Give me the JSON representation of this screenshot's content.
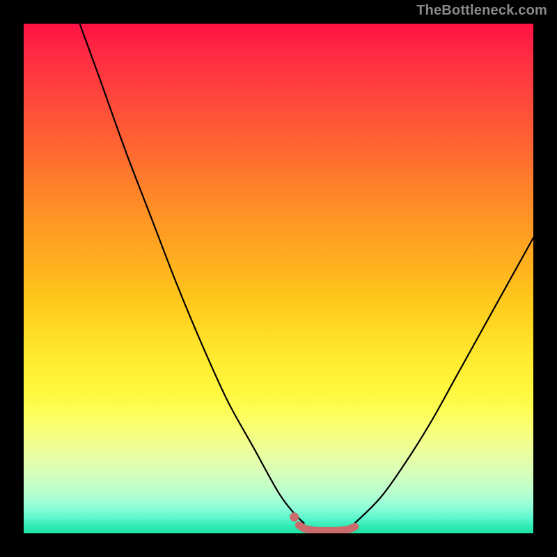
{
  "watermark": "TheBottleneck.com",
  "colors": {
    "curve": "#000000",
    "marker": "#CC6B6B",
    "background_black": "#000000"
  },
  "chart_data": {
    "type": "line",
    "title": "",
    "xlabel": "",
    "ylabel": "",
    "xlim": [
      0,
      100
    ],
    "ylim": [
      0,
      100
    ],
    "series": [
      {
        "name": "left-curve",
        "x": [
          11,
          15,
          20,
          25,
          30,
          35,
          40,
          45,
          50,
          53,
          55
        ],
        "y": [
          100,
          89,
          75,
          62,
          49,
          37,
          26,
          17,
          8,
          4,
          2
        ]
      },
      {
        "name": "right-curve",
        "x": [
          65,
          70,
          75,
          80,
          85,
          90,
          95,
          100
        ],
        "y": [
          2,
          7,
          14,
          22,
          31,
          40,
          49,
          58
        ]
      },
      {
        "name": "flat-bottom-marker",
        "x": [
          54,
          55,
          56,
          57,
          58,
          59,
          60,
          61,
          62,
          63,
          64,
          65
        ],
        "y": [
          1.6,
          1.0,
          0.7,
          0.55,
          0.5,
          0.5,
          0.5,
          0.5,
          0.55,
          0.65,
          0.85,
          1.3
        ]
      }
    ],
    "annotations": []
  }
}
